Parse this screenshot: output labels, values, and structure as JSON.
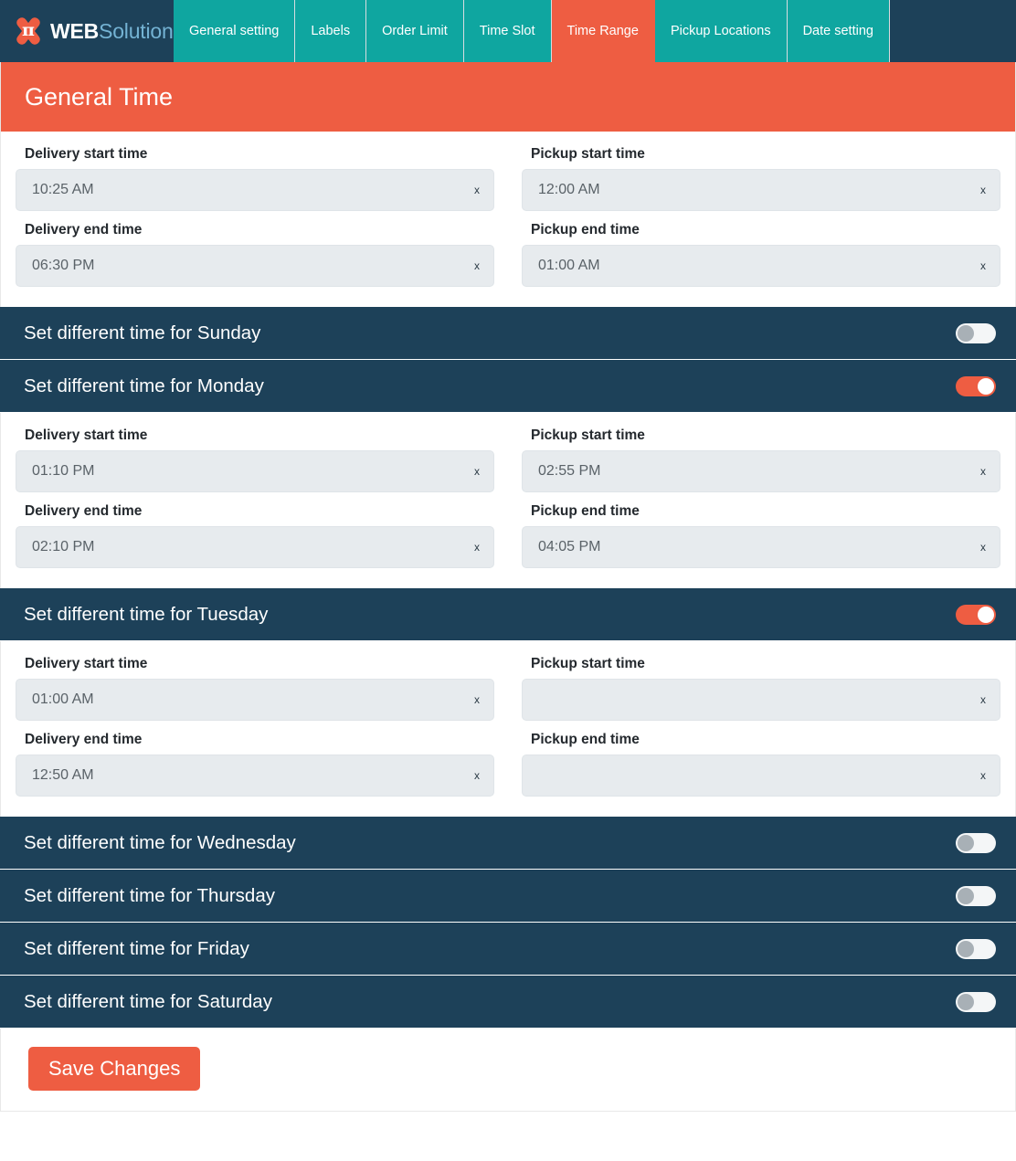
{
  "brand": {
    "word_mark_primary": "WEB",
    "word_mark_secondary": "Solution",
    "logo_glyph": "π"
  },
  "nav": {
    "tabs": [
      {
        "label": "General setting",
        "active": false
      },
      {
        "label": "Labels",
        "active": false
      },
      {
        "label": "Order Limit",
        "active": false
      },
      {
        "label": "Time Slot",
        "active": false
      },
      {
        "label": "Time Range",
        "active": true
      },
      {
        "label": "Pickup Locations",
        "active": false
      },
      {
        "label": "Date setting",
        "active": false
      }
    ]
  },
  "panel": {
    "title": "General Time"
  },
  "clear_label": "x",
  "labels": {
    "delivery_start": "Delivery start time",
    "delivery_end": "Delivery end time",
    "pickup_start": "Pickup start time",
    "pickup_end": "Pickup end time"
  },
  "general": {
    "delivery_start": "10:25 AM",
    "delivery_end": "06:30 PM",
    "pickup_start": "12:00 AM",
    "pickup_end": "01:00 AM"
  },
  "days": [
    {
      "key": "sunday",
      "label": "Set different time for Sunday",
      "enabled": false,
      "times": null
    },
    {
      "key": "monday",
      "label": "Set different time for Monday",
      "enabled": true,
      "times": {
        "delivery_start": "01:10 PM",
        "delivery_end": "02:10 PM",
        "pickup_start": "02:55 PM",
        "pickup_end": "04:05 PM"
      }
    },
    {
      "key": "tuesday",
      "label": "Set different time for Tuesday",
      "enabled": true,
      "times": {
        "delivery_start": "01:00 AM",
        "delivery_end": "12:50 AM",
        "pickup_start": "",
        "pickup_end": ""
      }
    },
    {
      "key": "wednesday",
      "label": "Set different time for Wednesday",
      "enabled": false,
      "times": null
    },
    {
      "key": "thursday",
      "label": "Set different time for Thursday",
      "enabled": false,
      "times": null
    },
    {
      "key": "friday",
      "label": "Set different time for Friday",
      "enabled": false,
      "times": null
    },
    {
      "key": "saturday",
      "label": "Set different time for Saturday",
      "enabled": false,
      "times": null
    }
  ],
  "footer": {
    "save_label": "Save Changes"
  },
  "colors": {
    "accent_orange": "#ee5d42",
    "nav_teal": "#0fa6a0",
    "dark_navy": "#1d4159",
    "field_grey": "#e7ebee",
    "brand_light_blue": "#74b3d4"
  }
}
